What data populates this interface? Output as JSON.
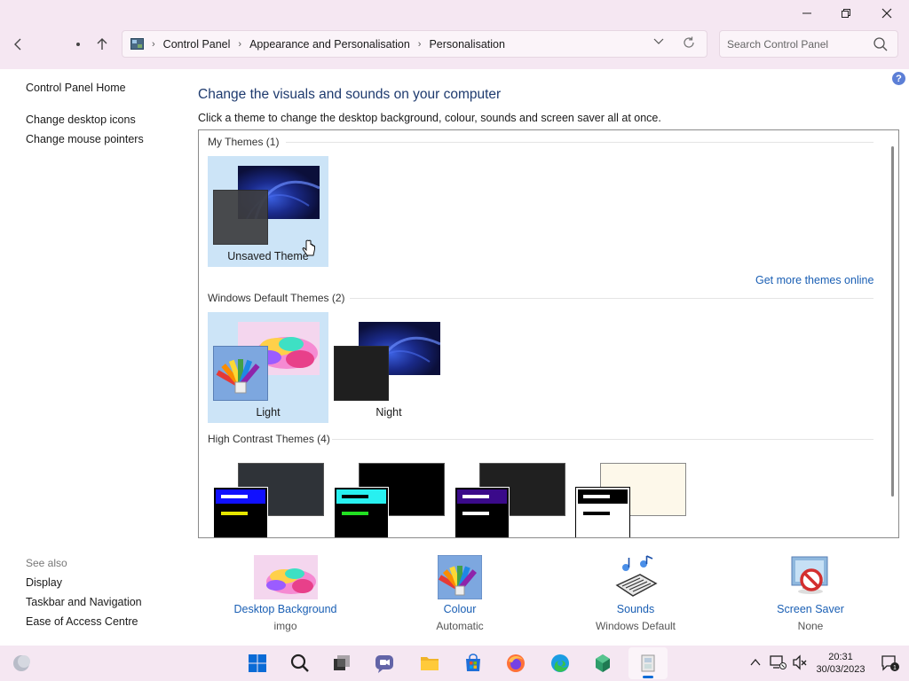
{
  "window": {
    "minimize_icon": "minimize-icon",
    "maximize_icon": "restore-icon",
    "close_icon": "close-icon"
  },
  "address": {
    "crumbs": [
      "Control Panel",
      "Appearance and Personalisation",
      "Personalisation"
    ]
  },
  "search": {
    "placeholder": "Search Control Panel"
  },
  "leftnav": {
    "home": "Control Panel Home",
    "links": [
      "Change desktop icons",
      "Change mouse pointers"
    ],
    "see_also": "See also",
    "see_also_links": [
      "Display",
      "Taskbar and Navigation",
      "Ease of Access Centre"
    ]
  },
  "main": {
    "title": "Change the visuals and sounds on your computer",
    "subtitle": "Click a theme to change the desktop background, colour, sounds and screen saver all at once.",
    "groups": {
      "my": {
        "label": "My Themes (1)",
        "themes": [
          "Unsaved Theme"
        ]
      },
      "default": {
        "label": "Windows Default Themes (2)",
        "themes": [
          "Light",
          "Night"
        ]
      },
      "contrast": {
        "label": "High Contrast Themes (4)"
      }
    },
    "more_themes_link": "Get more themes online"
  },
  "bottom": [
    {
      "label": "Desktop Background",
      "value": "imgo"
    },
    {
      "label": "Colour",
      "value": "Automatic"
    },
    {
      "label": "Sounds",
      "value": "Windows Default"
    },
    {
      "label": "Screen Saver",
      "value": "None"
    }
  ],
  "taskbar": {
    "time": "20:31",
    "date": "30/03/2023"
  },
  "colors": {
    "titlebar": "#f5e7f2",
    "link": "#1a5fb4",
    "selection": "#cce4f7"
  }
}
